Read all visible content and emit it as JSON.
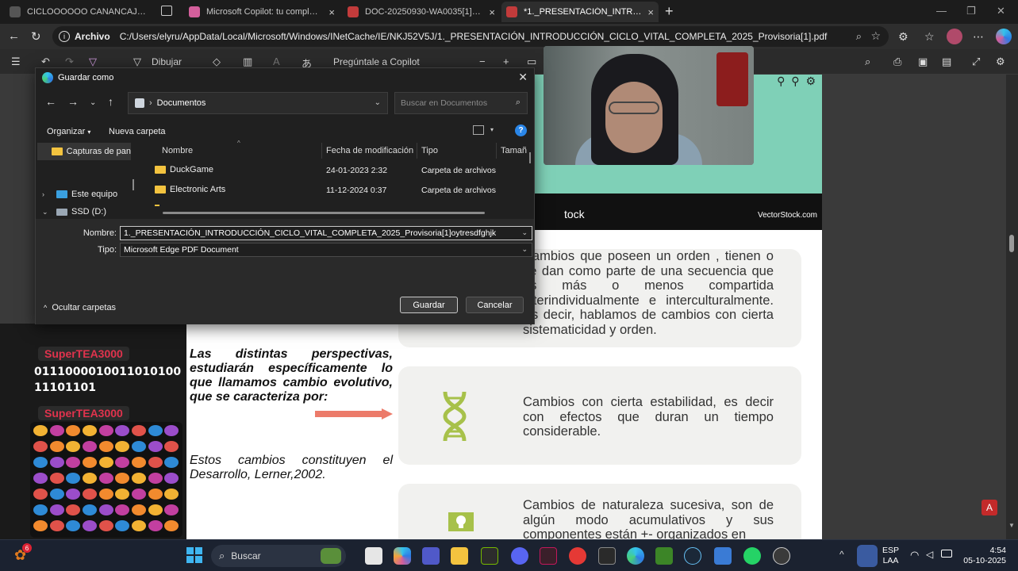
{
  "tabs": [
    {
      "title": "CICLOOOOOO CANANCAJSDNA",
      "fav_color": "#555555",
      "active": false
    },
    {
      "title": "Microsoft Copilot: tu complemento",
      "fav_color": "#d45f9c",
      "active": false
    },
    {
      "title": "DOC-20250930-WA0035[1].pdf",
      "fav_color": "#c23b3b",
      "active": false
    },
    {
      "title": "*1._PRESENTACIÓN_INTRODUCCIÓN",
      "fav_color": "#c23b3b",
      "active": true
    }
  ],
  "address": {
    "scheme": "Archivo",
    "path": "C:/Users/elyru/AppData/Local/Microsoft/Windows/INetCache/IE/NKJ52V5J/1._PRESENTACIÓN_INTRODUCCIÓN_CICLO_VITAL_COMPLETA_2025_Provisoria[1].pdf"
  },
  "pdf_toolbar": {
    "draw_label": "Dibujar",
    "copilot_label": "Pregúntale a Copilot"
  },
  "dialog": {
    "title": "Guardar como",
    "breadcrumb": "Documentos",
    "search_placeholder": "Buscar en Documentos",
    "organize_label": "Organizar",
    "new_folder_label": "Nueva carpeta",
    "nav_items": [
      {
        "label": "Capturas de pan",
        "type": "folder"
      },
      {
        "label": "Este equipo",
        "type": "pc"
      },
      {
        "label": "SSD (D:)",
        "type": "drive"
      }
    ],
    "columns": {
      "name": "Nombre",
      "modified": "Fecha de modificación",
      "type": "Tipo",
      "size": "Tamañ"
    },
    "files": [
      {
        "name": "DuckGame",
        "modified": "24-01-2023 2:32",
        "type": "Carpeta de archivos"
      },
      {
        "name": "Electronic Arts",
        "modified": "11-12-2024 0:37",
        "type": "Carpeta de archivos"
      }
    ],
    "name_label": "Nombre:",
    "name_value": "1._PRESENTACIÓN_INTRODUCCIÓN_CICLO_VITAL_COMPLETA_2025_Provisoria[1]oytresdfghjk",
    "type_label": "Tipo:",
    "type_value": "Microsoft Edge PDF Document",
    "hide_folders_label": "Ocultar carpetas",
    "save_label": "Guardar",
    "cancel_label": "Cancelar"
  },
  "slide": {
    "watermark_left": "tock",
    "watermark_right": "VectorStock.com",
    "card1_text": "Cambios que poseen un orden , tienen o se dan como parte de una secuencia que es más o menos compartida interindividualmente e interculturalmente. Es decir, hablamos de cambios con cierta sistematicidad y orden.",
    "card2_text": "Cambios con cierta estabilidad, es decir con efectos que duran un tiempo considerable.",
    "card3_text": "Cambios de naturaleza sucesiva, son de algún modo acumulativos y sus componentes están +- organizados en",
    "left_bold_text": "Las distintas perspectivas, estudiarán específicamente lo que llamamos cambio evolutivo, que se caracteriza por:",
    "left_text": "Estos cambios constituyen el Desarrollo, Lerner,2002.",
    "arrow_color": "#ec7b6a",
    "icon_color": "#a7c14a"
  },
  "stream": {
    "badge1": "SuperTEA3000",
    "binary": "011100001001101010011101101",
    "badge2": "SuperTEA3000"
  },
  "taskbar": {
    "search_label": "Buscar",
    "lang_top": "ESP",
    "lang_bottom": "LAA",
    "time": "4:54",
    "date": "05-10-2025",
    "notification_count": "6"
  }
}
